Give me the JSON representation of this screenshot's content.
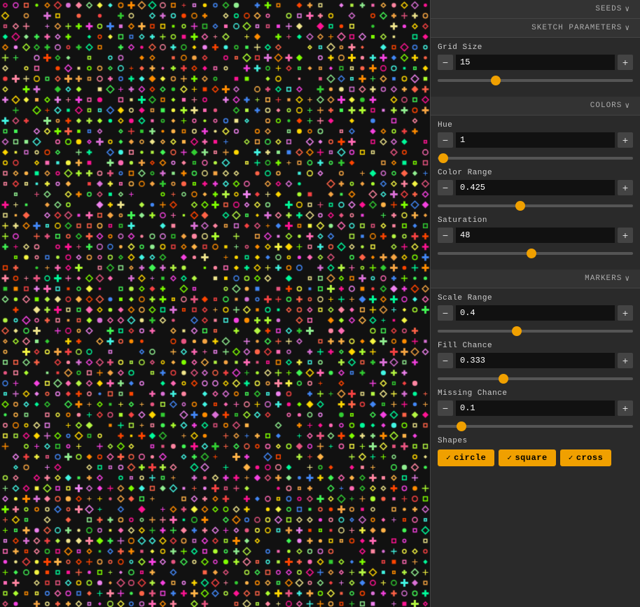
{
  "panel": {
    "seeds_label": "SEEDS",
    "sketch_params_label": "SKETCH PARAMETERS",
    "colors_label": "COLORS",
    "markers_label": "MARKERS",
    "chevron": "∨",
    "controls": {
      "grid_size": {
        "label": "Grid Size",
        "value": "15",
        "min": 1,
        "max": 50,
        "pct": 28
      },
      "hue": {
        "label": "Hue",
        "value": "1",
        "min": 0,
        "max": 360,
        "pct": 0.3
      },
      "color_range": {
        "label": "Color Range",
        "value": "0.425",
        "min": 0,
        "max": 1,
        "pct": 42.5
      },
      "saturation": {
        "label": "Saturation",
        "value": "48",
        "min": 0,
        "max": 100,
        "pct": 48
      },
      "scale_range": {
        "label": "Scale Range",
        "value": "0.4",
        "min": 0,
        "max": 1,
        "pct": 40
      },
      "fill_chance": {
        "label": "Fill Chance",
        "value": "0.333",
        "min": 0,
        "max": 1,
        "pct": 33.3
      },
      "missing_chance": {
        "label": "Missing Chance",
        "value": "0.1",
        "min": 0,
        "max": 1,
        "pct": 10
      }
    },
    "shapes": {
      "label": "Shapes",
      "items": [
        {
          "name": "circle",
          "checked": true
        },
        {
          "name": "square",
          "checked": true
        },
        {
          "name": "cross",
          "checked": true
        }
      ]
    }
  }
}
